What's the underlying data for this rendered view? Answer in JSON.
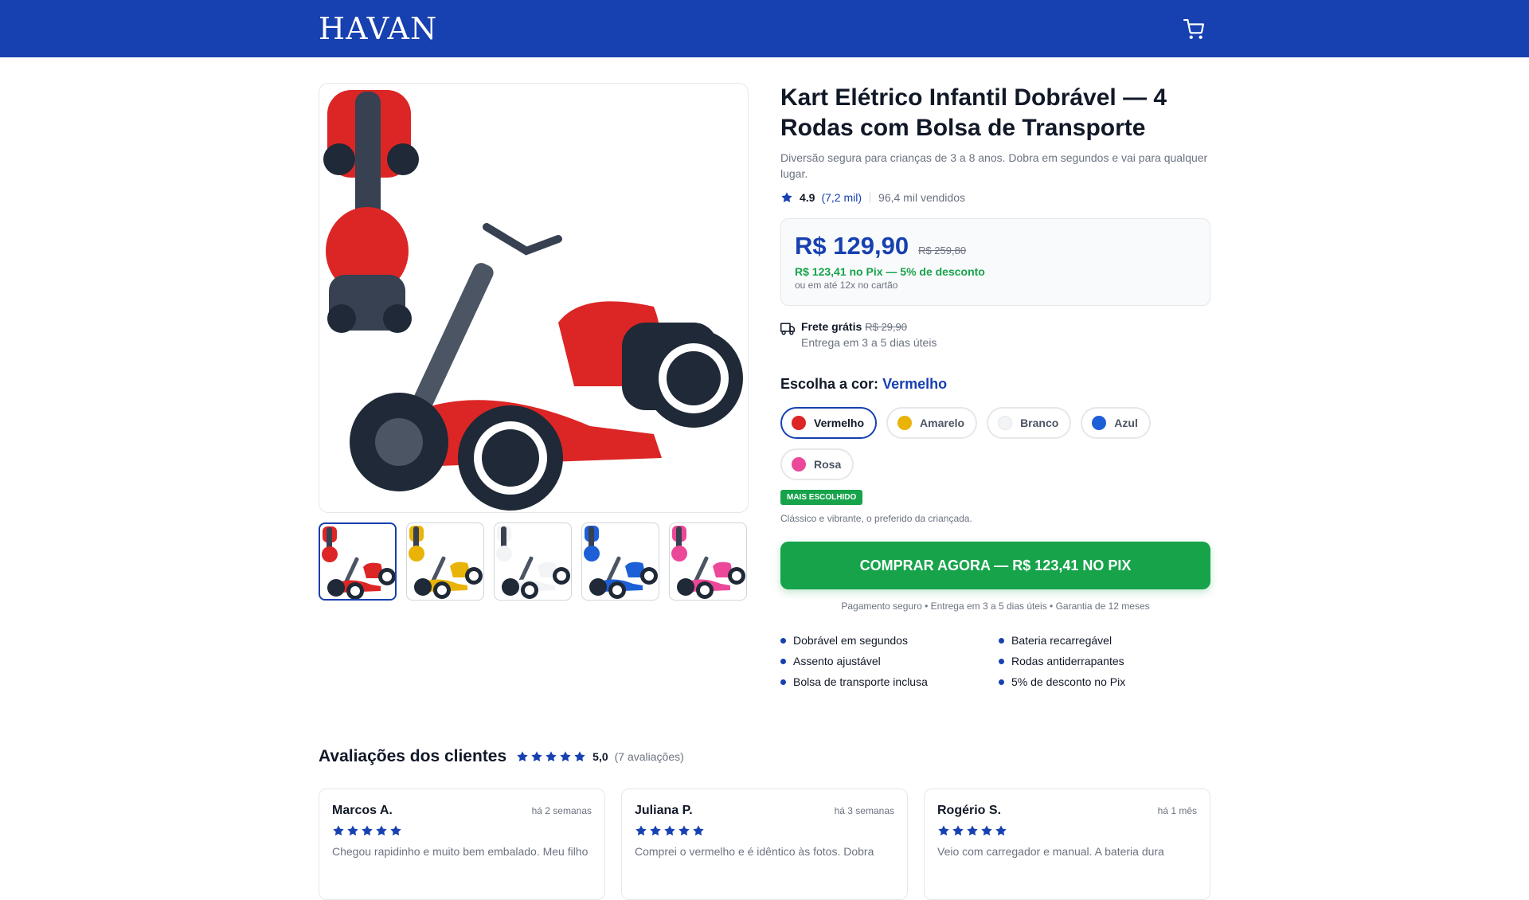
{
  "header": {
    "logo": "HAVAN",
    "cart_icon": "shopping-cart-icon",
    "bg_color": "#1740b0"
  },
  "product": {
    "title": "Kart Elétrico Infantil Dobrável — 4 Rodas com Bolsa de Transporte",
    "subtitle": "Diversão segura para crianças de 3 a 8 anos. Dobra em segundos e vai para qualquer lugar.",
    "rating": "4.9",
    "rating_count": "(7,2 mil)",
    "sold": "96,4 mil vendidos",
    "price": "R$ 129,90",
    "price_old": "R$ 259,80",
    "pix": "R$ 123,41 no Pix — 5% de desconto",
    "installments": "ou em até 12x no cartão",
    "shipping_label": "Frete grátis",
    "shipping_old": "R$ 29,90",
    "shipping_eta": "Entrega em 3 a 5 dias úteis",
    "color_label": "Escolha a cor:",
    "color_selected": "Vermelho",
    "colors": [
      {
        "name": "Vermelho",
        "hex": "#dc2626"
      },
      {
        "name": "Amarelo",
        "hex": "#eab308"
      },
      {
        "name": "Branco",
        "hex": "#f3f4f6"
      },
      {
        "name": "Azul",
        "hex": "#1d5fd6"
      },
      {
        "name": "Rosa",
        "hex": "#ec4899"
      }
    ],
    "badge": "MAIS ESCOLHIDO",
    "badge_note": "Clássico e vibrante, o preferido da criançada.",
    "buy_label": "COMPRAR AGORA — R$ 123,41 NO PIX",
    "secure_note": "Pagamento seguro • Entrega em 3 a 5 dias úteis • Garantia de 12 meses",
    "features": [
      "Dobrável em segundos",
      "Bateria recarregável",
      "Assento ajustável",
      "Rodas antiderrapantes",
      "Bolsa de transporte inclusa",
      "5% de desconto no Pix"
    ],
    "thumb_colors": [
      "#dc2626",
      "#eab308",
      "#f3f4f6",
      "#1d5fd6",
      "#ec4899"
    ]
  },
  "reviews": {
    "title": "Avaliações dos clientes",
    "average": "5,0",
    "count": "(7 avaliações)",
    "items": [
      {
        "name": "Marcos A.",
        "date": "há 2 semanas",
        "text": "Chegou rapidinho e muito bem embalado. Meu filho"
      },
      {
        "name": "Juliana P.",
        "date": "há 3 semanas",
        "text": "Comprei o vermelho e é idêntico às fotos. Dobra"
      },
      {
        "name": "Rogério S.",
        "date": "há 1 mês",
        "text": "Veio com carregador e manual. A bateria dura"
      }
    ]
  }
}
